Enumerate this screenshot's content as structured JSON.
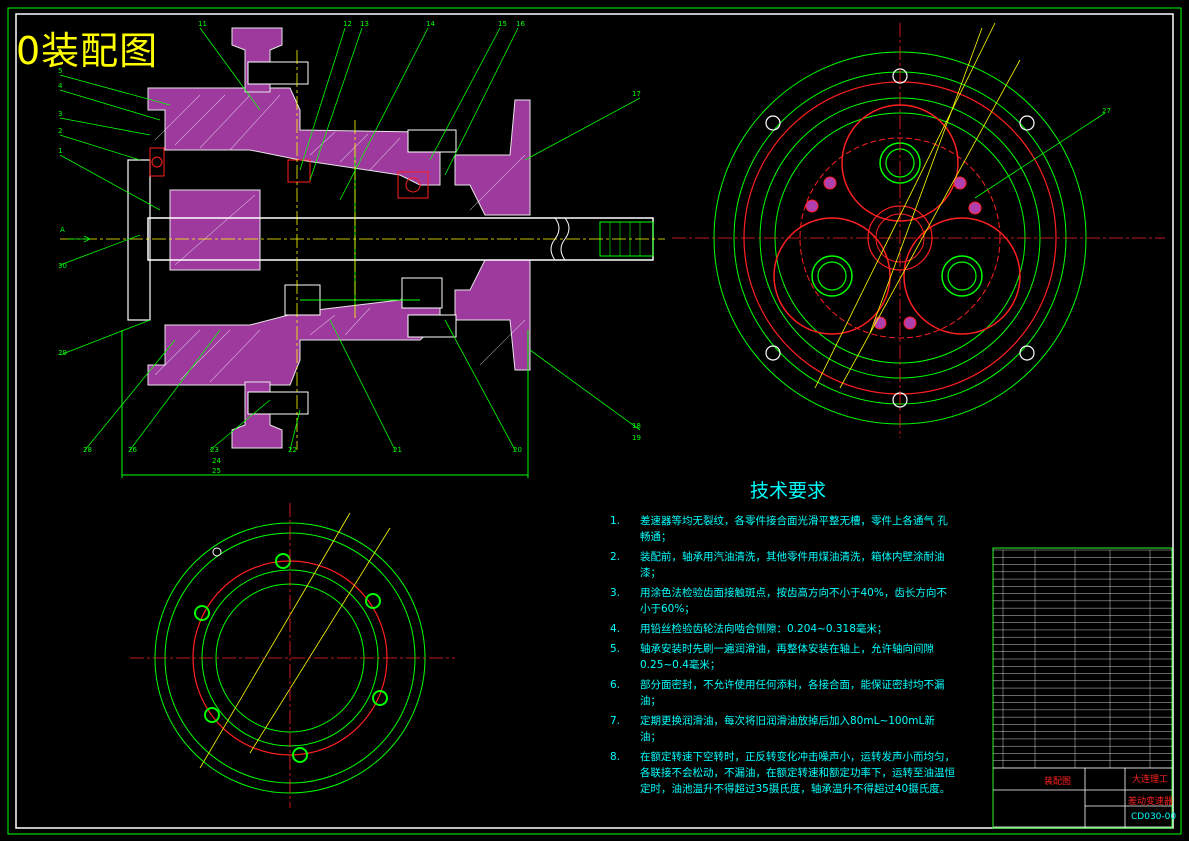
{
  "drawing": {
    "corner_title": "0装配图",
    "colors": {
      "background": "#000000",
      "outline": "#00ff00",
      "hatch": "#c040c0",
      "center_line": "#ffff00",
      "hidden_red": "#ff2020",
      "text_cyan": "#00ffff",
      "white": "#ffffff"
    }
  },
  "section_view": {
    "callouts": [
      "1",
      "2",
      "3",
      "4",
      "5",
      "11",
      "12",
      "13",
      "14",
      "15",
      "16",
      "17",
      "18",
      "19",
      "20",
      "21",
      "22",
      "23",
      "24",
      "25",
      "26",
      "27",
      "28",
      "29",
      "30"
    ],
    "view_marker": "A"
  },
  "tech_requirements": {
    "title": "技术要求",
    "items": [
      {
        "no": "1.",
        "text": "差速器等均无裂纹，各零件接合面光滑平整无槽，零件上各通气        孔畅通；"
      },
      {
        "no": "2.",
        "text": "装配前，轴承用汽油清洗，其他零件用煤油清洗，箱体内壁涂耐油漆；"
      },
      {
        "no": "3.",
        "text": "用涂色法检验齿面接触斑点，按齿高方向不小于40%，齿长方向不小于60%；"
      },
      {
        "no": "4.",
        "text": "用铅丝检验齿轮法向啮合侧隙：0.204~0.318毫米；"
      },
      {
        "no": "5.",
        "text": "轴承安装时先刷一遍润滑油，再整体安装在轴上，允许轴向间隙0.25~0.4毫米；"
      },
      {
        "no": "6.",
        "text": "部分面密封，不允许使用任何添料，各接合面，能保证密封均不漏油；"
      },
      {
        "no": "7.",
        "text": "定期更换润滑油，每次将旧润滑油放掉后加入80mL~100mL新油；"
      },
      {
        "no": "8.",
        "text": "在额定转速下空转时，正反转变化冲击噪声小，运转发声小而均匀，各联接不会松动，不漏油，在额定转速和额定功率下，运转至油温恒定时，油池温升不得超过35摄氏度，轴承温升不得超过40摄氏度。"
      }
    ]
  },
  "title_block": {
    "drawing_name": "装配图",
    "school": "大连理工",
    "product": "差动变速器",
    "drawing_no": "CD030-00"
  }
}
